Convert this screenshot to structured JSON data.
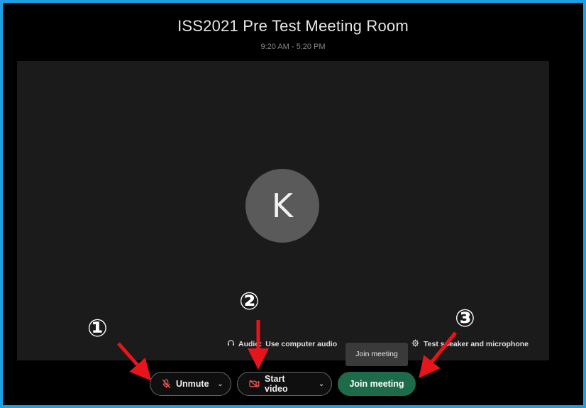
{
  "meeting": {
    "title": "ISS2021 Pre Test Meeting Room",
    "time": "9:20 AM - 5:20 PM"
  },
  "avatar": {
    "initial": "K",
    "color": "#5a5a5a"
  },
  "audio": {
    "label": "Audio: ",
    "value": "Use computer audio",
    "icon": "headset-icon"
  },
  "test": {
    "label": "Test speaker and microphone",
    "icon": "gear-icon"
  },
  "tooltip": {
    "text": "Join meeting"
  },
  "controls": {
    "unmute_label": "Unmute",
    "unmute_icon": "microphone-muted-icon",
    "start_video_label": "Start video",
    "start_video_icon": "video-off-icon",
    "join_label": "Join meeting"
  },
  "annotations": {
    "marker_1": "①",
    "marker_2": "②",
    "marker_3": "③"
  },
  "colors": {
    "frame_border": "#1ba1e2",
    "join_button": "#1d6b4a",
    "muted_icon": "#ff5a5a",
    "annotation_arrow": "#e8141c"
  }
}
